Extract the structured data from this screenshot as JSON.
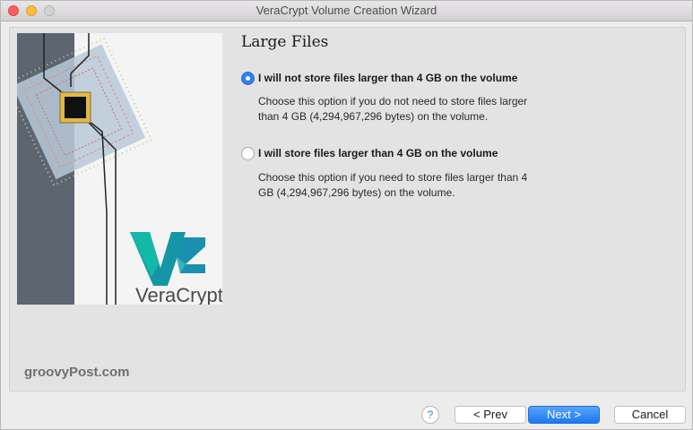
{
  "window": {
    "title": "VeraCrypt Volume Creation Wizard"
  },
  "page": {
    "heading": "Large Files"
  },
  "options": [
    {
      "label": "I will not store files larger than 4 GB on the volume",
      "desc_line1": "Choose this option if you do not need to store files larger",
      "desc_line2": "than 4 GB (4,294,967,296 bytes) on the volume.",
      "selected": true
    },
    {
      "label": "I will store files larger than 4 GB on the volume",
      "desc_line1": "Choose this option if you need to store files larger than 4",
      "desc_line2": "GB (4,294,967,296 bytes) on the volume.",
      "selected": false
    }
  ],
  "logo": {
    "text": "VeraCrypt",
    "brand_color": "#0fa3b1"
  },
  "watermark": "groovyPost.com",
  "buttons": {
    "help": "?",
    "prev": "< Prev",
    "next": "Next >",
    "cancel": "Cancel"
  }
}
